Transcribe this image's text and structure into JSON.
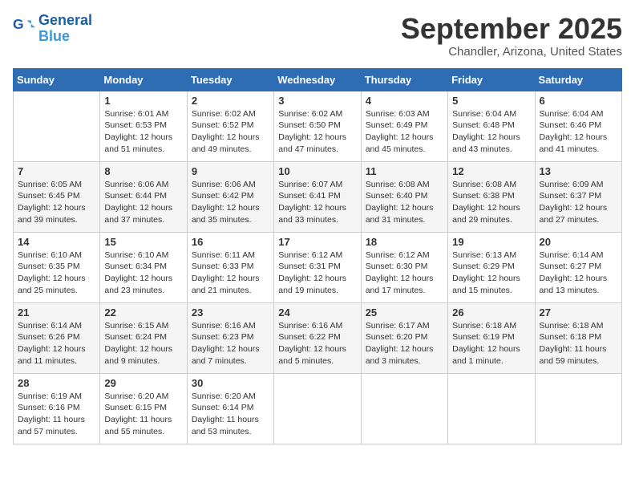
{
  "header": {
    "logo_line1": "General",
    "logo_line2": "Blue",
    "month": "September 2025",
    "location": "Chandler, Arizona, United States"
  },
  "weekdays": [
    "Sunday",
    "Monday",
    "Tuesday",
    "Wednesday",
    "Thursday",
    "Friday",
    "Saturday"
  ],
  "weeks": [
    [
      {
        "day": "",
        "info": ""
      },
      {
        "day": "1",
        "info": "Sunrise: 6:01 AM\nSunset: 6:53 PM\nDaylight: 12 hours\nand 51 minutes."
      },
      {
        "day": "2",
        "info": "Sunrise: 6:02 AM\nSunset: 6:52 PM\nDaylight: 12 hours\nand 49 minutes."
      },
      {
        "day": "3",
        "info": "Sunrise: 6:02 AM\nSunset: 6:50 PM\nDaylight: 12 hours\nand 47 minutes."
      },
      {
        "day": "4",
        "info": "Sunrise: 6:03 AM\nSunset: 6:49 PM\nDaylight: 12 hours\nand 45 minutes."
      },
      {
        "day": "5",
        "info": "Sunrise: 6:04 AM\nSunset: 6:48 PM\nDaylight: 12 hours\nand 43 minutes."
      },
      {
        "day": "6",
        "info": "Sunrise: 6:04 AM\nSunset: 6:46 PM\nDaylight: 12 hours\nand 41 minutes."
      }
    ],
    [
      {
        "day": "7",
        "info": "Sunrise: 6:05 AM\nSunset: 6:45 PM\nDaylight: 12 hours\nand 39 minutes."
      },
      {
        "day": "8",
        "info": "Sunrise: 6:06 AM\nSunset: 6:44 PM\nDaylight: 12 hours\nand 37 minutes."
      },
      {
        "day": "9",
        "info": "Sunrise: 6:06 AM\nSunset: 6:42 PM\nDaylight: 12 hours\nand 35 minutes."
      },
      {
        "day": "10",
        "info": "Sunrise: 6:07 AM\nSunset: 6:41 PM\nDaylight: 12 hours\nand 33 minutes."
      },
      {
        "day": "11",
        "info": "Sunrise: 6:08 AM\nSunset: 6:40 PM\nDaylight: 12 hours\nand 31 minutes."
      },
      {
        "day": "12",
        "info": "Sunrise: 6:08 AM\nSunset: 6:38 PM\nDaylight: 12 hours\nand 29 minutes."
      },
      {
        "day": "13",
        "info": "Sunrise: 6:09 AM\nSunset: 6:37 PM\nDaylight: 12 hours\nand 27 minutes."
      }
    ],
    [
      {
        "day": "14",
        "info": "Sunrise: 6:10 AM\nSunset: 6:35 PM\nDaylight: 12 hours\nand 25 minutes."
      },
      {
        "day": "15",
        "info": "Sunrise: 6:10 AM\nSunset: 6:34 PM\nDaylight: 12 hours\nand 23 minutes."
      },
      {
        "day": "16",
        "info": "Sunrise: 6:11 AM\nSunset: 6:33 PM\nDaylight: 12 hours\nand 21 minutes."
      },
      {
        "day": "17",
        "info": "Sunrise: 6:12 AM\nSunset: 6:31 PM\nDaylight: 12 hours\nand 19 minutes."
      },
      {
        "day": "18",
        "info": "Sunrise: 6:12 AM\nSunset: 6:30 PM\nDaylight: 12 hours\nand 17 minutes."
      },
      {
        "day": "19",
        "info": "Sunrise: 6:13 AM\nSunset: 6:29 PM\nDaylight: 12 hours\nand 15 minutes."
      },
      {
        "day": "20",
        "info": "Sunrise: 6:14 AM\nSunset: 6:27 PM\nDaylight: 12 hours\nand 13 minutes."
      }
    ],
    [
      {
        "day": "21",
        "info": "Sunrise: 6:14 AM\nSunset: 6:26 PM\nDaylight: 12 hours\nand 11 minutes."
      },
      {
        "day": "22",
        "info": "Sunrise: 6:15 AM\nSunset: 6:24 PM\nDaylight: 12 hours\nand 9 minutes."
      },
      {
        "day": "23",
        "info": "Sunrise: 6:16 AM\nSunset: 6:23 PM\nDaylight: 12 hours\nand 7 minutes."
      },
      {
        "day": "24",
        "info": "Sunrise: 6:16 AM\nSunset: 6:22 PM\nDaylight: 12 hours\nand 5 minutes."
      },
      {
        "day": "25",
        "info": "Sunrise: 6:17 AM\nSunset: 6:20 PM\nDaylight: 12 hours\nand 3 minutes."
      },
      {
        "day": "26",
        "info": "Sunrise: 6:18 AM\nSunset: 6:19 PM\nDaylight: 12 hours\nand 1 minute."
      },
      {
        "day": "27",
        "info": "Sunrise: 6:18 AM\nSunset: 6:18 PM\nDaylight: 11 hours\nand 59 minutes."
      }
    ],
    [
      {
        "day": "28",
        "info": "Sunrise: 6:19 AM\nSunset: 6:16 PM\nDaylight: 11 hours\nand 57 minutes."
      },
      {
        "day": "29",
        "info": "Sunrise: 6:20 AM\nSunset: 6:15 PM\nDaylight: 11 hours\nand 55 minutes."
      },
      {
        "day": "30",
        "info": "Sunrise: 6:20 AM\nSunset: 6:14 PM\nDaylight: 11 hours\nand 53 minutes."
      },
      {
        "day": "",
        "info": ""
      },
      {
        "day": "",
        "info": ""
      },
      {
        "day": "",
        "info": ""
      },
      {
        "day": "",
        "info": ""
      }
    ]
  ]
}
